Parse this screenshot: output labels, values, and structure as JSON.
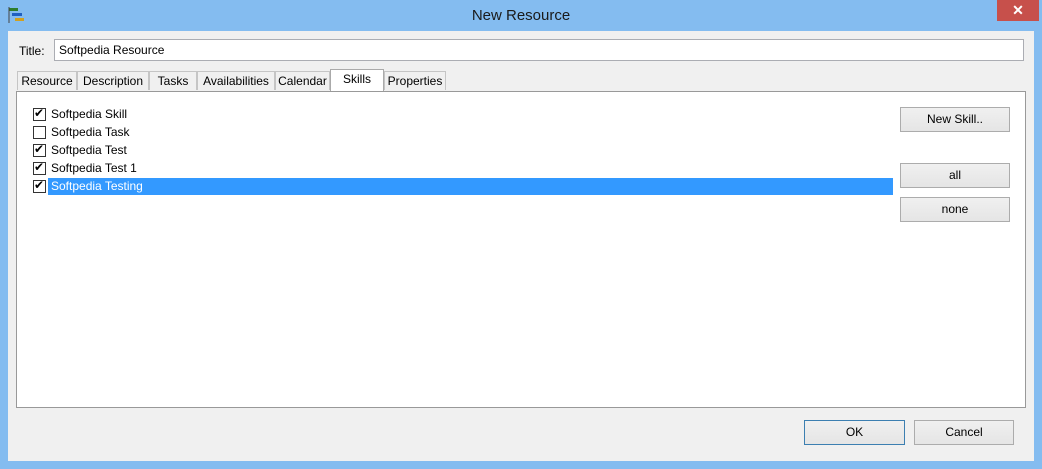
{
  "window": {
    "title": "New Resource",
    "close_glyph": "✕"
  },
  "form": {
    "title_label": "Title:",
    "title_value": "Softpedia Resource"
  },
  "tabs": [
    {
      "label": "Resource"
    },
    {
      "label": "Description"
    },
    {
      "label": "Tasks"
    },
    {
      "label": "Availabilities"
    },
    {
      "label": "Calendar"
    },
    {
      "label": "Skills",
      "active": true
    },
    {
      "label": "Properties"
    }
  ],
  "skills": [
    {
      "label": "Softpedia Skill",
      "checked": true
    },
    {
      "label": "Softpedia Task",
      "checked": false
    },
    {
      "label": "Softpedia Test",
      "checked": true
    },
    {
      "label": "Softpedia Test 1",
      "checked": true
    },
    {
      "label": "Softpedia Testing",
      "checked": true,
      "selected": true
    }
  ],
  "skill_buttons": {
    "new_skill": "New Skill..",
    "all": "all",
    "none": "none"
  },
  "dialog_buttons": {
    "ok": "OK",
    "cancel": "Cancel"
  },
  "colors": {
    "frame": "#84bcf0",
    "selection": "#3399ff",
    "close": "#c7504b"
  }
}
